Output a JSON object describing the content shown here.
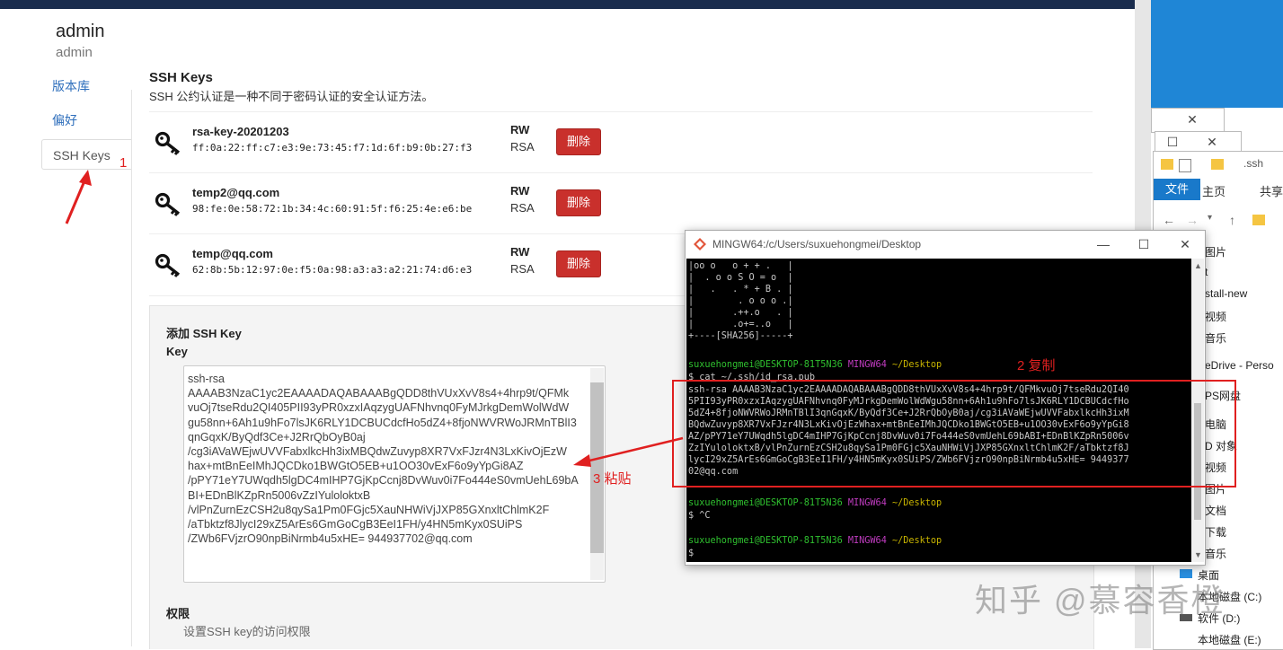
{
  "user": {
    "name": "admin",
    "username": "admin"
  },
  "nav": {
    "items": [
      {
        "label": "版本库"
      },
      {
        "label": "偏好"
      },
      {
        "label": "SSH Keys"
      }
    ]
  },
  "ssh": {
    "title": "SSH Keys",
    "description": "SSH 公约认证是一种不同于密码认证的安全认证方法。",
    "keys": [
      {
        "name": "rsa-key-20201203",
        "fingerprint": "ff:0a:22:ff:c7:e3:9e:73:45:f7:1d:6f:b9:0b:27:f3",
        "perm": "RW",
        "type": "RSA",
        "delete_label": "删除"
      },
      {
        "name": "temp2@qq.com",
        "fingerprint": "98:fe:0e:58:72:1b:34:4c:60:91:5f:f6:25:4e:e6:be",
        "perm": "RW",
        "type": "RSA",
        "delete_label": "删除"
      },
      {
        "name": "temp@qq.com",
        "fingerprint": "62:8b:5b:12:97:0e:f5:0a:98:a3:a3:a2:21:74:d6:e3",
        "perm": "RW",
        "type": "RSA",
        "delete_label": "删除"
      }
    ]
  },
  "add": {
    "title": "添加 SSH Key",
    "key_label": "Key",
    "key_lines": [
      "ssh-rsa",
      "AAAAB3NzaC1yc2EAAAADAQABAAABgQDD8thVUxXvV8s4+4hrp9t/QFMk",
      "vuOj7tseRdu2QI405PII93yPR0xzxIAqzygUAFNhvnq0FyMJrkgDemWolWdW",
      "gu58nn+6Ah1u9hFo7lsJK6RLY1DCBUCdcfHo5dZ4+8fjoNWVRWoJRMnTBlI3",
      "qnGqxK/ByQdf3Ce+J2RrQbOyB0aj",
      "/cg3iAVaWEjwUVVFabxlkcHh3ixMBQdwZuvyp8XR7VxFJzr4N3LxKivOjEzW",
      "hax+mtBnEeIMhJQCDko1BWGtO5EB+u1OO30vExF6o9yYpGi8AZ",
      "/pPY71eY7UWqdh5lgDC4mIHP7GjKpCcnj8DvWuv0i7Fo444eS0vmUehL69bA",
      "BI+EDnBlKZpRn5006vZzIYuloloktxB",
      "/vlPnZurnEzCSH2u8qySa1Pm0FGjc5XauNHWiVjJXP85GXnxltChlmK2F",
      "/aTbktzf8JlycI29xZ5ArEs6GmGoCgB3EeI1FH/y4HN5mKyx0SUiPS",
      "/ZWb6FVjzrO90npBiNrmb4u5xHE= 944937702@qq.com"
    ],
    "perm_title": "权限",
    "perm_desc": "设置SSH key的访问权限"
  },
  "terminal": {
    "title": "MINGW64:/c/Users/suxuehongmei/Desktop",
    "art": [
      "|oo o   o + + .   |",
      "|  . o o S O = o  |",
      "|   .   . * + B . |",
      "|        . o o o .|",
      "|       .++.o   . |",
      "|       .o+=..o   |",
      "+----[SHA256]-----+"
    ],
    "prompt_user": "suxuehongmei@DESKTOP-81T5N36",
    "prompt_env": "MINGW64",
    "prompt_dir": "~/Desktop",
    "cmd1": "$ cat ~/.ssh/id_rsa.pub",
    "output": [
      "ssh-rsa AAAAB3NzaC1yc2EAAAADAQABAAABgQDD8thVUxXvV8s4+4hrp9t/QFMkvuOj7tseRdu2QI40",
      "5PII93yPR0xzxIAqzygUAFNhvnq0FyMJrkgDemWolWdWgu58nn+6Ah1u9hFo7lsJK6RLY1DCBUCdcfHo",
      "5dZ4+8fjoNWVRWoJRMnTBlI3qnGqxK/ByQdf3Ce+J2RrQbOyB0aj/cg3iAVaWEjwUVVFabxlkcHh3ixM",
      "BQdwZuvyp8XR7VxFJzr4N3LxKivOjEzWhax+mtBnEeIMhJQCDko1BWGtO5EB+u1OO30vExF6o9yYpGi8",
      "AZ/pPY71eY7UWqdh5lgDC4mIHP7GjKpCcnj8DvWuv0i7Fo444eS0vmUehL69bABI+EDnBlKZpRn5006v",
      "ZzIYuloloktxB/vlPnZurnEzCSH2u8qySa1Pm0FGjc5XauNHWiVjJXP85GXnxltChlmK2F/aTbktzf8J",
      "lycI29xZ5ArEs6GmGoCgB3EeI1FH/y4HN5mKyx0SUiPS/ZWb6FVjzrO90npBiNrmb4u5xHE= 9449377",
      "02@qq.com"
    ],
    "cmd2": "$ ^C",
    "cmd3": "$ "
  },
  "annotations": {
    "a1": "1",
    "a2": "2 复制",
    "a3": "3 粘贴"
  },
  "explorer": {
    "path": ".ssh",
    "tabs": [
      "文件",
      "主页",
      "共享"
    ],
    "items": [
      "图片",
      "t",
      "stall-new",
      "视频",
      "音乐",
      "eDrive - Perso",
      "PS网盘",
      "电脑",
      "D 对象",
      "视频",
      "图片",
      "文档",
      "下载",
      "音乐",
      "桌面",
      "本地磁盘 (C:)",
      "软件 (D:)",
      "本地磁盘 (E:)"
    ]
  },
  "watermark": "知乎 @慕容香橙",
  "colors": {
    "topbar": "#1a2c4d",
    "danger": "#c9302c",
    "link": "#2f6fbc",
    "annotation": "#e02020",
    "desktop": "#1f86d6"
  }
}
